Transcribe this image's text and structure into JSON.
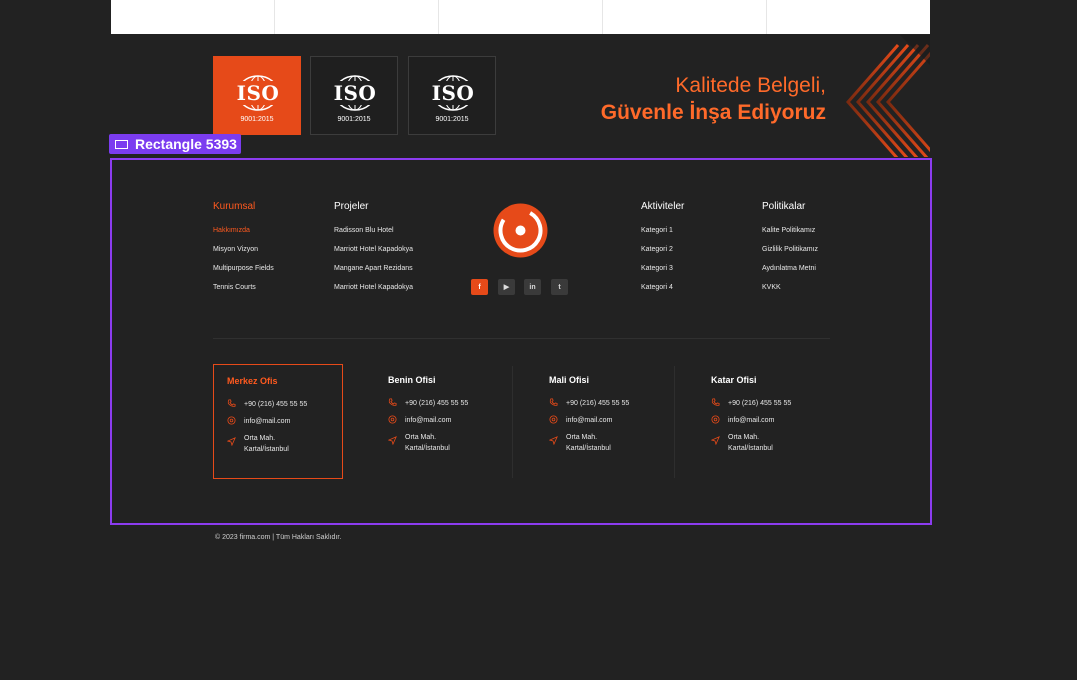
{
  "iso_badges": [
    {
      "label": "ISO",
      "standard": "9001:2015",
      "active": true
    },
    {
      "label": "ISO",
      "standard": "9001:2015",
      "active": false
    },
    {
      "label": "ISO",
      "standard": "9001:2015",
      "active": false
    }
  ],
  "quality": {
    "line1": "Kalitede Belgeli,",
    "line2": "Güvenle İnşa Ediyoruz"
  },
  "selection": {
    "label": "Rectangle 5393"
  },
  "footer": {
    "kurumsal": {
      "title": "Kurumsal",
      "items": [
        "Hakkımızda",
        "Misyon Vizyon",
        "Multipurpose Fields",
        "Tennis Courts"
      ]
    },
    "projeler": {
      "title": "Projeler",
      "items": [
        "Radisson Blu Hotel",
        "Marriott Hotel Kapadokya",
        "Mangane Apart Rezidans",
        "Marriott Hotel Kapadokya"
      ]
    },
    "aktiviteler": {
      "title": "Aktiviteler",
      "items": [
        "Kategori 1",
        "Kategori 2",
        "Kategori 3",
        "Kategori 4"
      ]
    },
    "politikalar": {
      "title": "Politikalar",
      "items": [
        "Kalite Politikamız",
        "Gizlilik Politikamız",
        "Aydınlatma Metni",
        "KVKK"
      ]
    }
  },
  "social": [
    {
      "name": "facebook",
      "glyph": "f"
    },
    {
      "name": "youtube",
      "glyph": "▶"
    },
    {
      "name": "linkedin",
      "glyph": "in"
    },
    {
      "name": "twitter",
      "glyph": "t"
    }
  ],
  "offices": [
    {
      "title": "Merkez Ofis",
      "phone": "+90 (216) 455 55 55",
      "email": "info@mail.com",
      "address1": "Orta Mah.",
      "address2": "Kartal/İstanbul",
      "active": true
    },
    {
      "title": "Benin Ofisi",
      "phone": "+90 (216) 455 55 55",
      "email": "info@mail.com",
      "address1": "Orta Mah.",
      "address2": "Kartal/İstanbul",
      "active": false
    },
    {
      "title": "Mali Ofisi",
      "phone": "+90 (216) 455 55 55",
      "email": "info@mail.com",
      "address1": "Orta Mah.",
      "address2": "Kartal/İstanbul",
      "active": false
    },
    {
      "title": "Katar Ofisi",
      "phone": "+90 (216) 455 55 55",
      "email": "info@mail.com",
      "address1": "Orta Mah.",
      "address2": "Kartal/İstanbul",
      "active": false
    }
  ],
  "copyright": "© 2023 firma.com | Tüm Hakları Saklıdır.",
  "colors": {
    "accent": "#e64a19",
    "background": "#222222",
    "selection": "#8c3cf0"
  }
}
